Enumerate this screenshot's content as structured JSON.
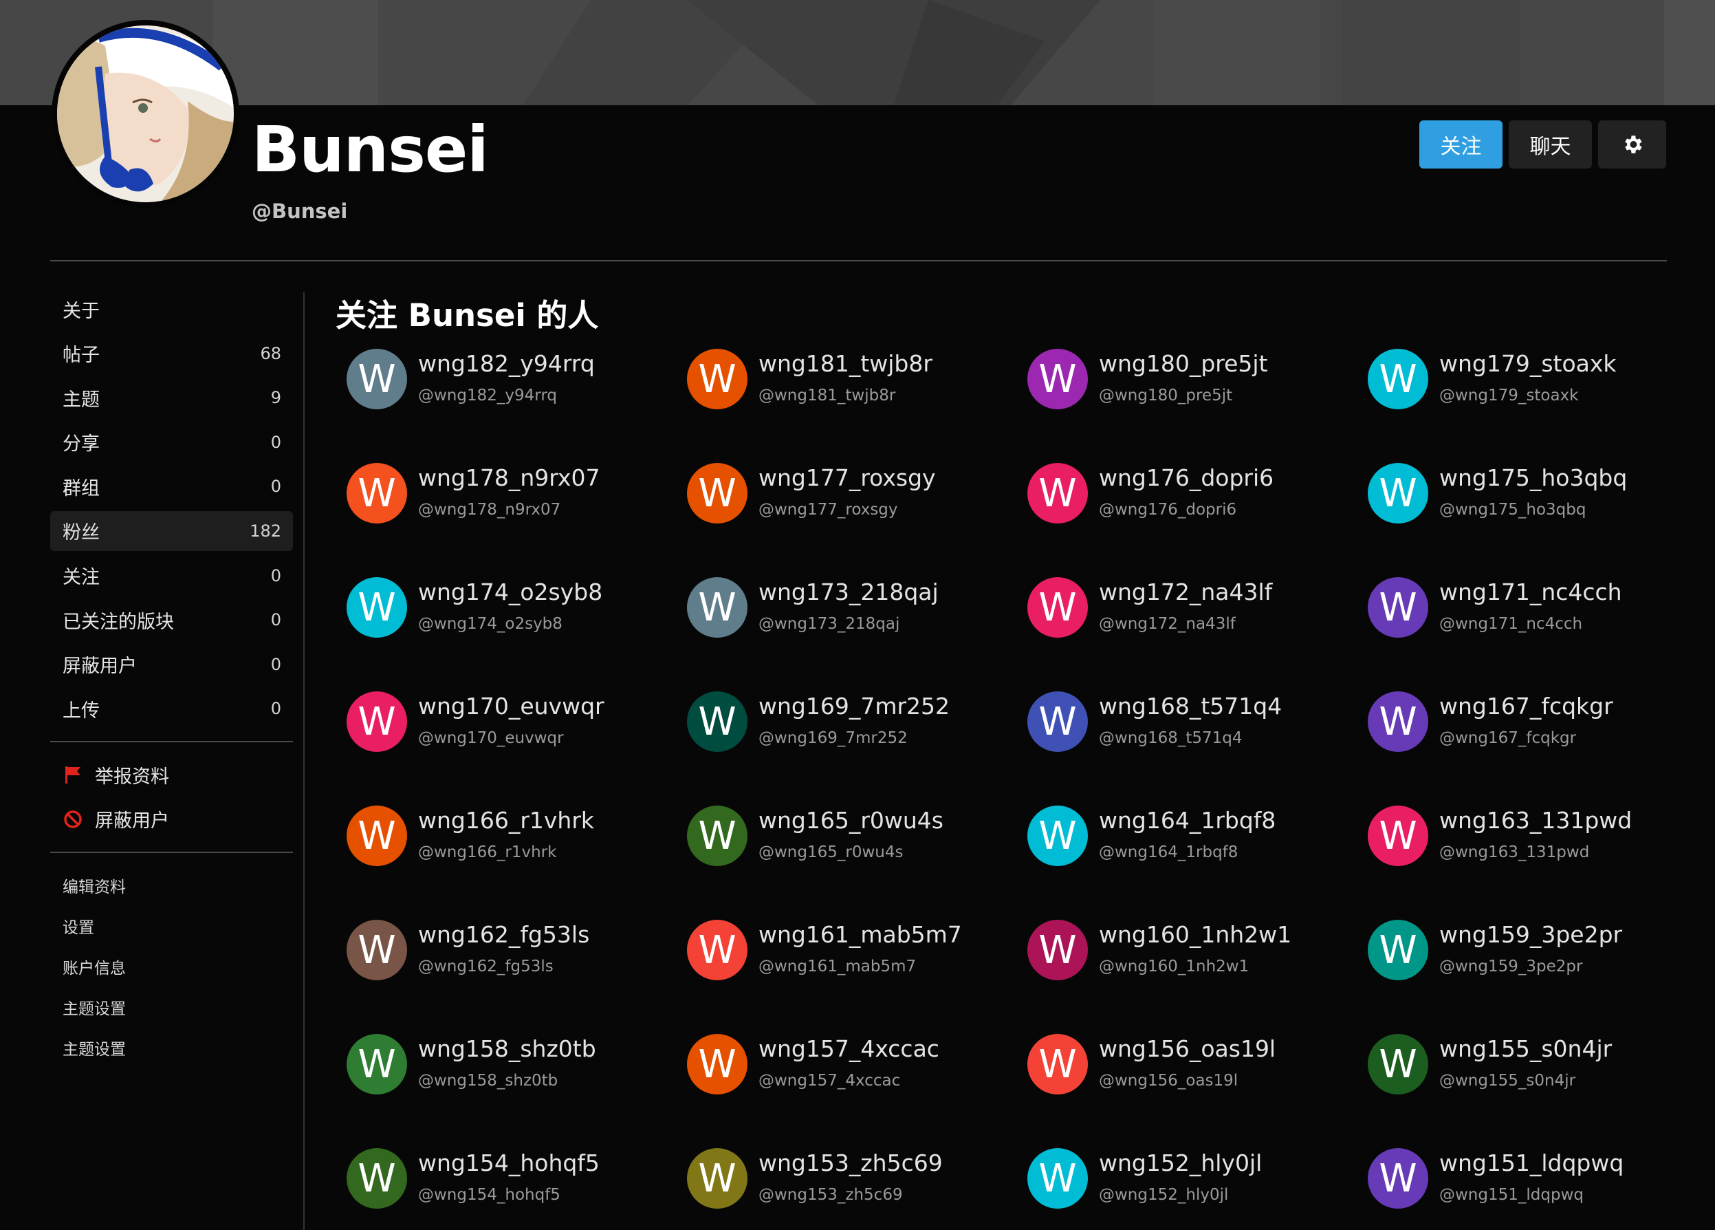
{
  "profile": {
    "display_name": "Bunsei",
    "handle": "@Bunsei"
  },
  "actions": {
    "follow_label": "关注",
    "chat_label": "聊天",
    "settings_icon": "gear-icon"
  },
  "colors": {
    "accent": "#2f9fe1",
    "page_bg": "#070707",
    "cover_bg": "#474747"
  },
  "sidebar": {
    "nav": [
      {
        "label": "关于",
        "count": ""
      },
      {
        "label": "帖子",
        "count": "68"
      },
      {
        "label": "主题",
        "count": "9"
      },
      {
        "label": "分享",
        "count": "0"
      },
      {
        "label": "群组",
        "count": "0"
      },
      {
        "label": "粉丝",
        "count": "182",
        "active": true
      },
      {
        "label": "关注",
        "count": "0"
      },
      {
        "label": "已关注的版块",
        "count": "0"
      },
      {
        "label": "屏蔽用户",
        "count": "0"
      },
      {
        "label": "上传",
        "count": "0"
      }
    ],
    "actions": [
      {
        "label": "举报资料",
        "icon": "flag-icon"
      },
      {
        "label": "屏蔽用户",
        "icon": "ban-icon"
      }
    ],
    "owner_links": [
      {
        "label": "编辑资料"
      },
      {
        "label": "设置"
      },
      {
        "label": "账户信息"
      },
      {
        "label": "主题设置"
      },
      {
        "label": "主题设置"
      }
    ]
  },
  "main": {
    "title": "关注 Bunsei 的人",
    "followers": [
      {
        "name": "wng182_y94rrq",
        "handle": "@wng182_y94rrq",
        "initial": "W",
        "color": "#607d8b"
      },
      {
        "name": "wng181_twjb8r",
        "handle": "@wng181_twjb8r",
        "initial": "W",
        "color": "#e65100"
      },
      {
        "name": "wng180_pre5jt",
        "handle": "@wng180_pre5jt",
        "initial": "W",
        "color": "#9c27b0"
      },
      {
        "name": "wng179_stoaxk",
        "handle": "@wng179_stoaxk",
        "initial": "W",
        "color": "#00bcd4"
      },
      {
        "name": "wng178_n9rx07",
        "handle": "@wng178_n9rx07",
        "initial": "W",
        "color": "#f4511e"
      },
      {
        "name": "wng177_roxsgy",
        "handle": "@wng177_roxsgy",
        "initial": "W",
        "color": "#e65100"
      },
      {
        "name": "wng176_dopri6",
        "handle": "@wng176_dopri6",
        "initial": "W",
        "color": "#e91e63"
      },
      {
        "name": "wng175_ho3qbq",
        "handle": "@wng175_ho3qbq",
        "initial": "W",
        "color": "#00bcd4"
      },
      {
        "name": "wng174_o2syb8",
        "handle": "@wng174_o2syb8",
        "initial": "W",
        "color": "#00bcd4"
      },
      {
        "name": "wng173_218qaj",
        "handle": "@wng173_218qaj",
        "initial": "W",
        "color": "#607d8b"
      },
      {
        "name": "wng172_na43lf",
        "handle": "@wng172_na43lf",
        "initial": "W",
        "color": "#e91e63"
      },
      {
        "name": "wng171_nc4cch",
        "handle": "@wng171_nc4cch",
        "initial": "W",
        "color": "#673ab7"
      },
      {
        "name": "wng170_euvwqr",
        "handle": "@wng170_euvwqr",
        "initial": "W",
        "color": "#e91e63"
      },
      {
        "name": "wng169_7mr252",
        "handle": "@wng169_7mr252",
        "initial": "W",
        "color": "#004d40"
      },
      {
        "name": "wng168_t571q4",
        "handle": "@wng168_t571q4",
        "initial": "W",
        "color": "#3f51b5"
      },
      {
        "name": "wng167_fcqkgr",
        "handle": "@wng167_fcqkgr",
        "initial": "W",
        "color": "#673ab7"
      },
      {
        "name": "wng166_r1vhrk",
        "handle": "@wng166_r1vhrk",
        "initial": "W",
        "color": "#e65100"
      },
      {
        "name": "wng165_r0wu4s",
        "handle": "@wng165_r0wu4s",
        "initial": "W",
        "color": "#33691e"
      },
      {
        "name": "wng164_1rbqf8",
        "handle": "@wng164_1rbqf8",
        "initial": "W",
        "color": "#00bcd4"
      },
      {
        "name": "wng163_131pwd",
        "handle": "@wng163_131pwd",
        "initial": "W",
        "color": "#e91e63"
      },
      {
        "name": "wng162_fg53ls",
        "handle": "@wng162_fg53ls",
        "initial": "W",
        "color": "#795548"
      },
      {
        "name": "wng161_mab5m7",
        "handle": "@wng161_mab5m7",
        "initial": "W",
        "color": "#f44336"
      },
      {
        "name": "wng160_1nh2w1",
        "handle": "@wng160_1nh2w1",
        "initial": "W",
        "color": "#ad1457"
      },
      {
        "name": "wng159_3pe2pr",
        "handle": "@wng159_3pe2pr",
        "initial": "W",
        "color": "#009688"
      },
      {
        "name": "wng158_shz0tb",
        "handle": "@wng158_shz0tb",
        "initial": "W",
        "color": "#2e7d32"
      },
      {
        "name": "wng157_4xccac",
        "handle": "@wng157_4xccac",
        "initial": "W",
        "color": "#e65100"
      },
      {
        "name": "wng156_oas19l",
        "handle": "@wng156_oas19l",
        "initial": "W",
        "color": "#f44336"
      },
      {
        "name": "wng155_s0n4jr",
        "handle": "@wng155_s0n4jr",
        "initial": "W",
        "color": "#1b5e20"
      },
      {
        "name": "wng154_hohqf5",
        "handle": "@wng154_hohqf5",
        "initial": "W",
        "color": "#33691e"
      },
      {
        "name": "wng153_zh5c69",
        "handle": "@wng153_zh5c69",
        "initial": "W",
        "color": "#827717"
      },
      {
        "name": "wng152_hly0jl",
        "handle": "@wng152_hly0jl",
        "initial": "W",
        "color": "#00bcd4"
      },
      {
        "name": "wng151_ldqpwq",
        "handle": "@wng151_ldqpwq",
        "initial": "W",
        "color": "#673ab7"
      }
    ]
  }
}
